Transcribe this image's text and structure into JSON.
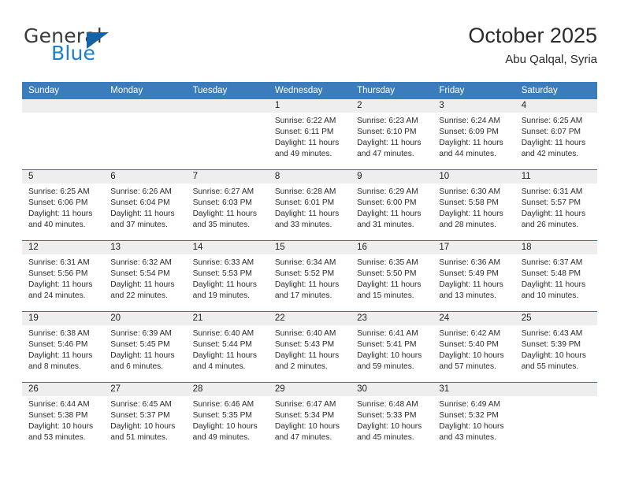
{
  "brand": {
    "name_top": "General",
    "name_bottom": "Blue",
    "color_top": "#3b3b3b",
    "color_bottom": "#1b7fcc",
    "triangle_color": "#1464a5"
  },
  "header": {
    "title": "October 2025",
    "subtitle": "Abu Qalqal, Syria"
  },
  "theme": {
    "header_row_bg": "#3b7cbd",
    "header_row_text": "#ffffff",
    "daynum_band_bg": "#eeeeee",
    "week_divider": "#3f6f9f"
  },
  "calendar": {
    "weekday_headers": [
      "Sunday",
      "Monday",
      "Tuesday",
      "Wednesday",
      "Thursday",
      "Friday",
      "Saturday"
    ],
    "weeks": [
      [
        {
          "day": "",
          "sunrise": "",
          "sunset": "",
          "daylight_line1": "",
          "daylight_line2": ""
        },
        {
          "day": "",
          "sunrise": "",
          "sunset": "",
          "daylight_line1": "",
          "daylight_line2": ""
        },
        {
          "day": "",
          "sunrise": "",
          "sunset": "",
          "daylight_line1": "",
          "daylight_line2": ""
        },
        {
          "day": "1",
          "sunrise": "Sunrise: 6:22 AM",
          "sunset": "Sunset: 6:11 PM",
          "daylight_line1": "Daylight: 11 hours",
          "daylight_line2": "and 49 minutes."
        },
        {
          "day": "2",
          "sunrise": "Sunrise: 6:23 AM",
          "sunset": "Sunset: 6:10 PM",
          "daylight_line1": "Daylight: 11 hours",
          "daylight_line2": "and 47 minutes."
        },
        {
          "day": "3",
          "sunrise": "Sunrise: 6:24 AM",
          "sunset": "Sunset: 6:09 PM",
          "daylight_line1": "Daylight: 11 hours",
          "daylight_line2": "and 44 minutes."
        },
        {
          "day": "4",
          "sunrise": "Sunrise: 6:25 AM",
          "sunset": "Sunset: 6:07 PM",
          "daylight_line1": "Daylight: 11 hours",
          "daylight_line2": "and 42 minutes."
        }
      ],
      [
        {
          "day": "5",
          "sunrise": "Sunrise: 6:25 AM",
          "sunset": "Sunset: 6:06 PM",
          "daylight_line1": "Daylight: 11 hours",
          "daylight_line2": "and 40 minutes."
        },
        {
          "day": "6",
          "sunrise": "Sunrise: 6:26 AM",
          "sunset": "Sunset: 6:04 PM",
          "daylight_line1": "Daylight: 11 hours",
          "daylight_line2": "and 37 minutes."
        },
        {
          "day": "7",
          "sunrise": "Sunrise: 6:27 AM",
          "sunset": "Sunset: 6:03 PM",
          "daylight_line1": "Daylight: 11 hours",
          "daylight_line2": "and 35 minutes."
        },
        {
          "day": "8",
          "sunrise": "Sunrise: 6:28 AM",
          "sunset": "Sunset: 6:01 PM",
          "daylight_line1": "Daylight: 11 hours",
          "daylight_line2": "and 33 minutes."
        },
        {
          "day": "9",
          "sunrise": "Sunrise: 6:29 AM",
          "sunset": "Sunset: 6:00 PM",
          "daylight_line1": "Daylight: 11 hours",
          "daylight_line2": "and 31 minutes."
        },
        {
          "day": "10",
          "sunrise": "Sunrise: 6:30 AM",
          "sunset": "Sunset: 5:58 PM",
          "daylight_line1": "Daylight: 11 hours",
          "daylight_line2": "and 28 minutes."
        },
        {
          "day": "11",
          "sunrise": "Sunrise: 6:31 AM",
          "sunset": "Sunset: 5:57 PM",
          "daylight_line1": "Daylight: 11 hours",
          "daylight_line2": "and 26 minutes."
        }
      ],
      [
        {
          "day": "12",
          "sunrise": "Sunrise: 6:31 AM",
          "sunset": "Sunset: 5:56 PM",
          "daylight_line1": "Daylight: 11 hours",
          "daylight_line2": "and 24 minutes."
        },
        {
          "day": "13",
          "sunrise": "Sunrise: 6:32 AM",
          "sunset": "Sunset: 5:54 PM",
          "daylight_line1": "Daylight: 11 hours",
          "daylight_line2": "and 22 minutes."
        },
        {
          "day": "14",
          "sunrise": "Sunrise: 6:33 AM",
          "sunset": "Sunset: 5:53 PM",
          "daylight_line1": "Daylight: 11 hours",
          "daylight_line2": "and 19 minutes."
        },
        {
          "day": "15",
          "sunrise": "Sunrise: 6:34 AM",
          "sunset": "Sunset: 5:52 PM",
          "daylight_line1": "Daylight: 11 hours",
          "daylight_line2": "and 17 minutes."
        },
        {
          "day": "16",
          "sunrise": "Sunrise: 6:35 AM",
          "sunset": "Sunset: 5:50 PM",
          "daylight_line1": "Daylight: 11 hours",
          "daylight_line2": "and 15 minutes."
        },
        {
          "day": "17",
          "sunrise": "Sunrise: 6:36 AM",
          "sunset": "Sunset: 5:49 PM",
          "daylight_line1": "Daylight: 11 hours",
          "daylight_line2": "and 13 minutes."
        },
        {
          "day": "18",
          "sunrise": "Sunrise: 6:37 AM",
          "sunset": "Sunset: 5:48 PM",
          "daylight_line1": "Daylight: 11 hours",
          "daylight_line2": "and 10 minutes."
        }
      ],
      [
        {
          "day": "19",
          "sunrise": "Sunrise: 6:38 AM",
          "sunset": "Sunset: 5:46 PM",
          "daylight_line1": "Daylight: 11 hours",
          "daylight_line2": "and 8 minutes."
        },
        {
          "day": "20",
          "sunrise": "Sunrise: 6:39 AM",
          "sunset": "Sunset: 5:45 PM",
          "daylight_line1": "Daylight: 11 hours",
          "daylight_line2": "and 6 minutes."
        },
        {
          "day": "21",
          "sunrise": "Sunrise: 6:40 AM",
          "sunset": "Sunset: 5:44 PM",
          "daylight_line1": "Daylight: 11 hours",
          "daylight_line2": "and 4 minutes."
        },
        {
          "day": "22",
          "sunrise": "Sunrise: 6:40 AM",
          "sunset": "Sunset: 5:43 PM",
          "daylight_line1": "Daylight: 11 hours",
          "daylight_line2": "and 2 minutes."
        },
        {
          "day": "23",
          "sunrise": "Sunrise: 6:41 AM",
          "sunset": "Sunset: 5:41 PM",
          "daylight_line1": "Daylight: 10 hours",
          "daylight_line2": "and 59 minutes."
        },
        {
          "day": "24",
          "sunrise": "Sunrise: 6:42 AM",
          "sunset": "Sunset: 5:40 PM",
          "daylight_line1": "Daylight: 10 hours",
          "daylight_line2": "and 57 minutes."
        },
        {
          "day": "25",
          "sunrise": "Sunrise: 6:43 AM",
          "sunset": "Sunset: 5:39 PM",
          "daylight_line1": "Daylight: 10 hours",
          "daylight_line2": "and 55 minutes."
        }
      ],
      [
        {
          "day": "26",
          "sunrise": "Sunrise: 6:44 AM",
          "sunset": "Sunset: 5:38 PM",
          "daylight_line1": "Daylight: 10 hours",
          "daylight_line2": "and 53 minutes."
        },
        {
          "day": "27",
          "sunrise": "Sunrise: 6:45 AM",
          "sunset": "Sunset: 5:37 PM",
          "daylight_line1": "Daylight: 10 hours",
          "daylight_line2": "and 51 minutes."
        },
        {
          "day": "28",
          "sunrise": "Sunrise: 6:46 AM",
          "sunset": "Sunset: 5:35 PM",
          "daylight_line1": "Daylight: 10 hours",
          "daylight_line2": "and 49 minutes."
        },
        {
          "day": "29",
          "sunrise": "Sunrise: 6:47 AM",
          "sunset": "Sunset: 5:34 PM",
          "daylight_line1": "Daylight: 10 hours",
          "daylight_line2": "and 47 minutes."
        },
        {
          "day": "30",
          "sunrise": "Sunrise: 6:48 AM",
          "sunset": "Sunset: 5:33 PM",
          "daylight_line1": "Daylight: 10 hours",
          "daylight_line2": "and 45 minutes."
        },
        {
          "day": "31",
          "sunrise": "Sunrise: 6:49 AM",
          "sunset": "Sunset: 5:32 PM",
          "daylight_line1": "Daylight: 10 hours",
          "daylight_line2": "and 43 minutes."
        },
        {
          "day": "",
          "sunrise": "",
          "sunset": "",
          "daylight_line1": "",
          "daylight_line2": ""
        }
      ]
    ]
  }
}
